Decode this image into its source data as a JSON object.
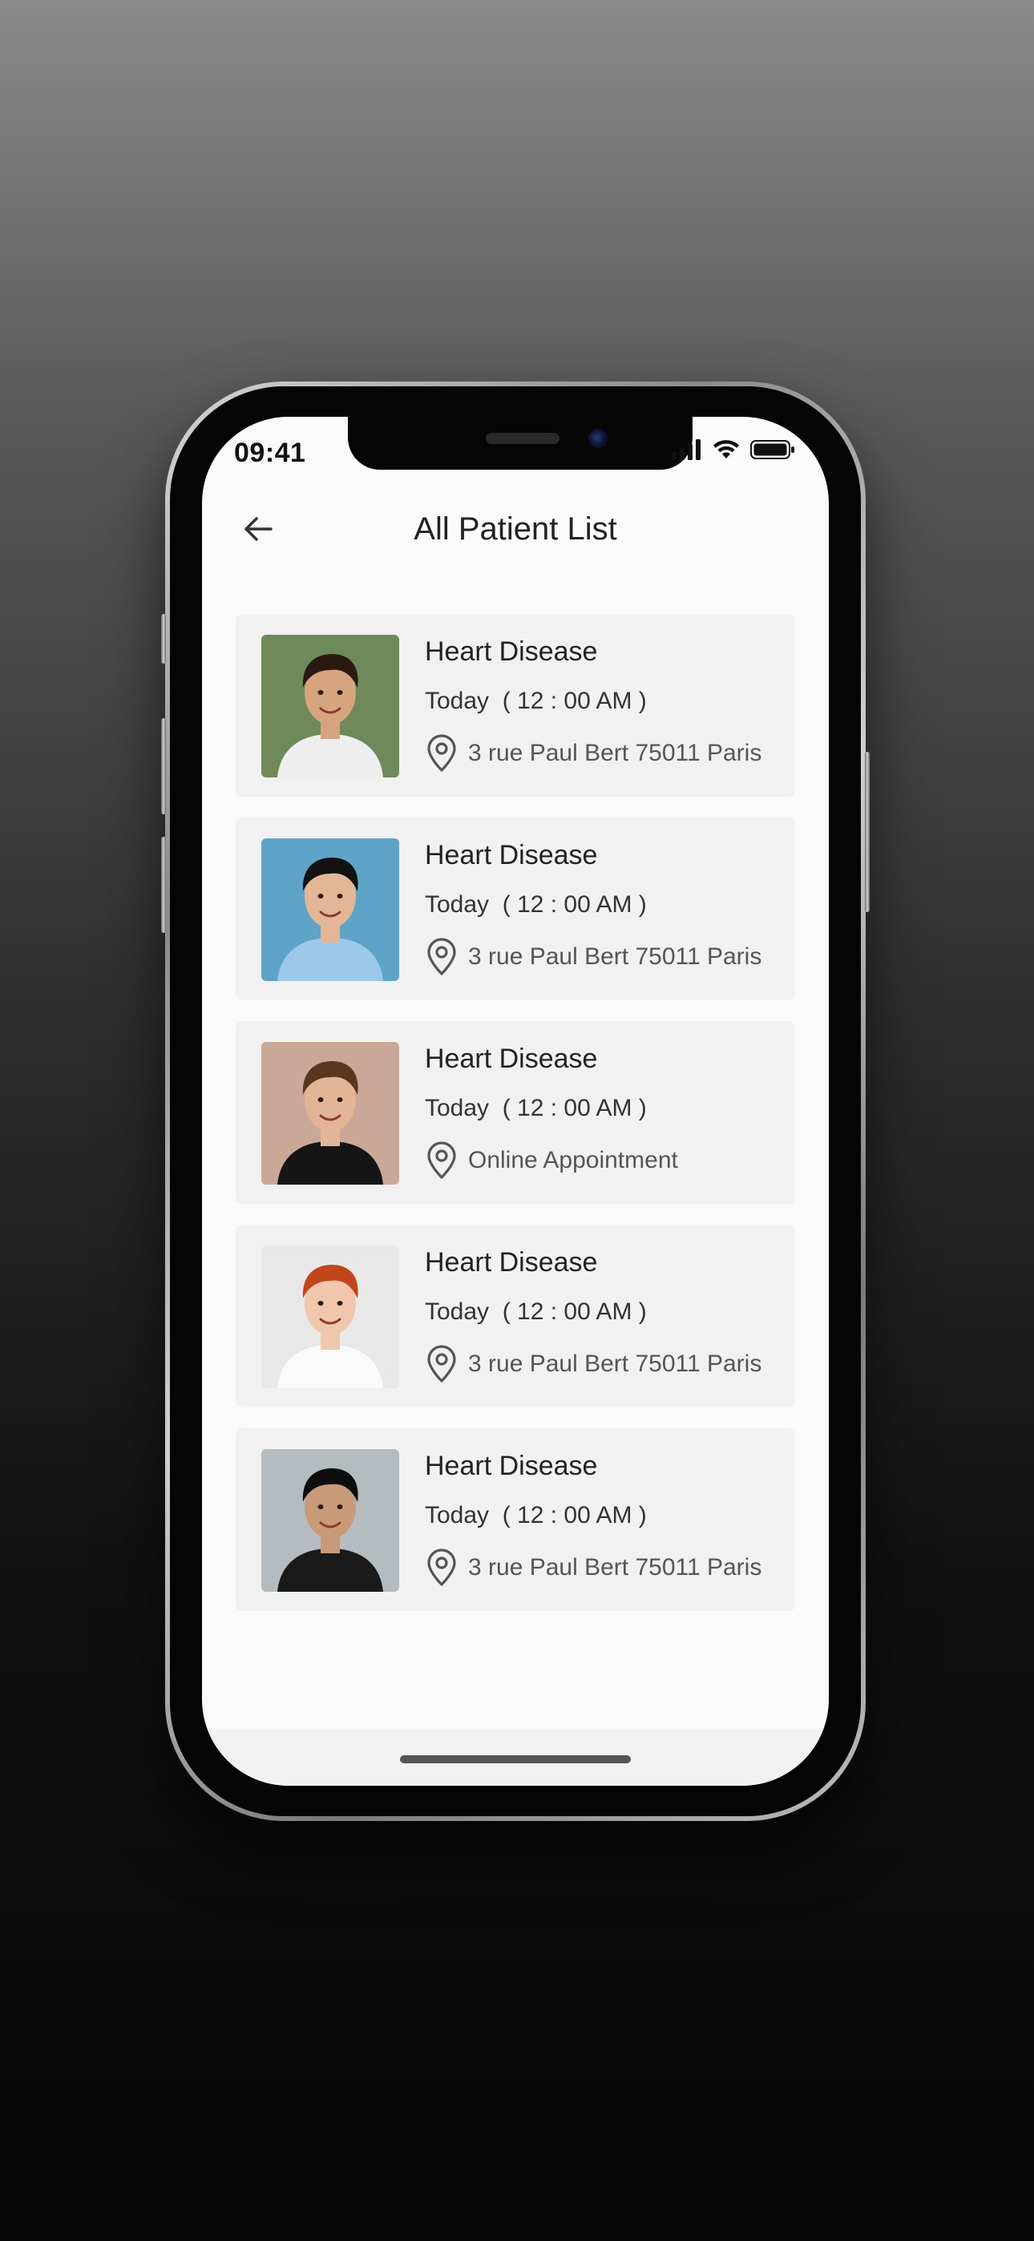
{
  "status_bar": {
    "time": "09:41"
  },
  "header": {
    "title": "All Patient List",
    "back_icon": "arrow-left-icon"
  },
  "patients": [
    {
      "title": "Heart Disease",
      "time": "Today  ( 12 : 00 AM )",
      "location": "3 rue Paul Bert 75011 Paris",
      "photo_bg": "#6f8a5a",
      "skin": "#d6a47e",
      "hair": "#2a1a12",
      "shirt": "#eeeeee"
    },
    {
      "title": "Heart Disease",
      "time": "Today  ( 12 : 00 AM )",
      "location": "3 rue Paul Bert 75011 Paris",
      "photo_bg": "#5da4c8",
      "skin": "#e3b796",
      "hair": "#111111",
      "shirt": "#9cc9ea"
    },
    {
      "title": "Heart Disease",
      "time": "Today  ( 12 : 00 AM )",
      "location": "Online Appointment",
      "photo_bg": "#c9a897",
      "skin": "#e2b597",
      "hair": "#5a3520",
      "shirt": "#151515"
    },
    {
      "title": "Heart Disease",
      "time": "Today  ( 12 : 00 AM )",
      "location": "3 rue Paul Bert 75011 Paris",
      "photo_bg": "#e8e8e8",
      "skin": "#f0c7ad",
      "hair": "#c2461c",
      "shirt": "#fafafa"
    },
    {
      "title": "Heart Disease",
      "time": "Today  ( 12 : 00 AM )",
      "location": "3 rue Paul Bert 75011 Paris",
      "photo_bg": "#b5bcc0",
      "skin": "#c99a78",
      "hair": "#0e0e0e",
      "shirt": "#1a1a1a"
    }
  ],
  "colors": {
    "screen_bg": "#fafafa",
    "card_bg": "#f1f1f1",
    "text_primary": "#222222",
    "text_secondary": "#555555"
  }
}
